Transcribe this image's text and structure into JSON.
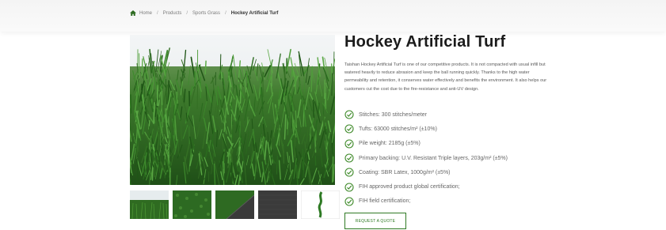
{
  "breadcrumb": {
    "home": "Home",
    "products": "Products",
    "category": "Sports Grass",
    "current": "Hockey Artificial Turf",
    "separator": "/"
  },
  "product": {
    "title": "Hockey Artificial Turf",
    "description": "Taishan Hockey Artificial Turf is one of our competitive products. It is not compacted with usual infill but watered heavily to reduce abrasion and keep the ball running quickly. Thanks to the high water permeability and retention, it conserves water effectively and benefits the environment. It also helps our customers cut the cost due to the fire-resistance and anti-UV design.",
    "features": [
      "Stitches: 300 stitches/meter",
      "Tufts: 63000 stitches/m² (±10%)",
      "Pile weight: 2185g (±5%)",
      "Primary backing: U.V. Resistant Triple layers, 203g/m² (±5%)",
      "Coating: SBR Latex, 1000g/m² (±5%)",
      "FIH approved product global certification;",
      "FIH field certification;"
    ],
    "cta_label": "REQUEST A QUOTE"
  },
  "icons": {
    "home": "home-icon",
    "check": "check-circle-icon"
  },
  "colors": {
    "accent": "#3f8a2a",
    "title": "#1b1b1b",
    "turf": "#2f6b21"
  }
}
